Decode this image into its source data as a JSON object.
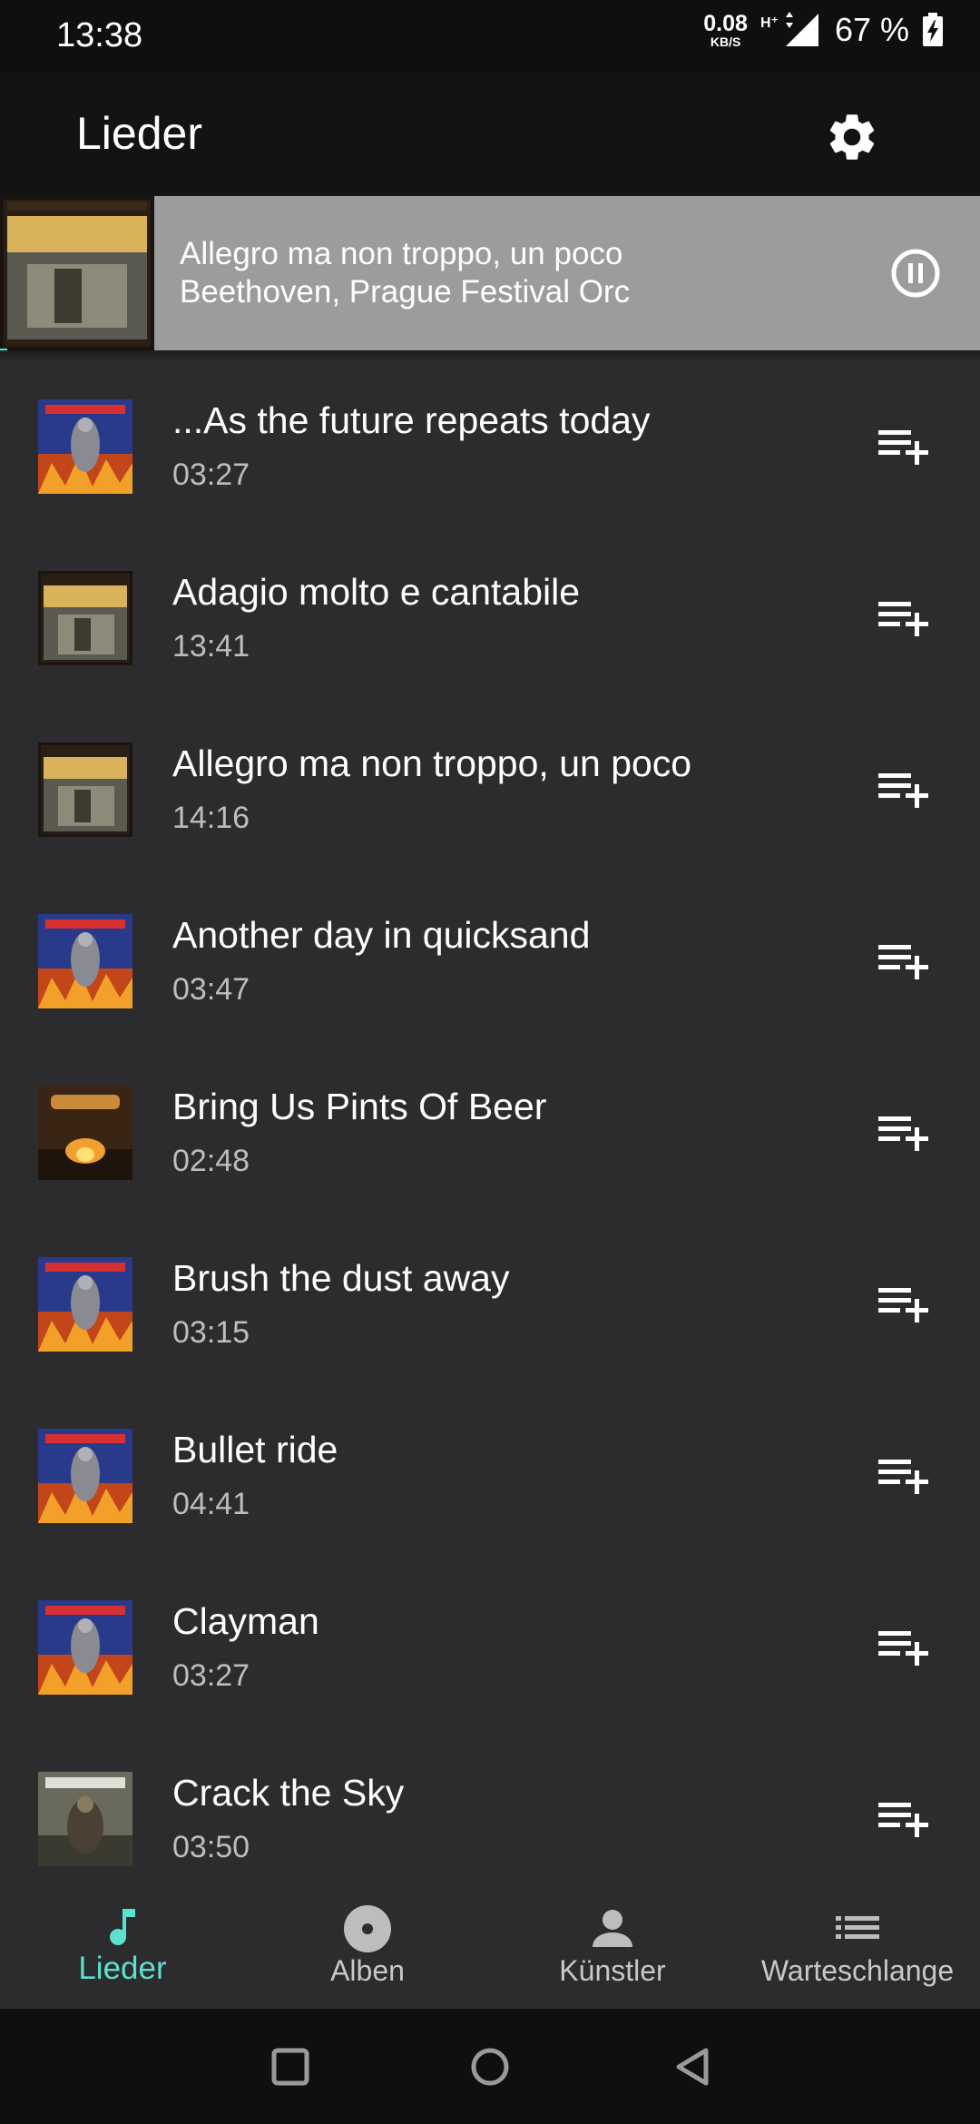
{
  "status": {
    "time": "13:38",
    "net_speed": "0.08",
    "net_unit": "KB/S",
    "network_type": "H⁺",
    "battery": "67 %"
  },
  "appbar": {
    "title": "Lieder",
    "settings_icon": "gear-icon"
  },
  "now_playing": {
    "title": "Allegro ma non troppo, un poco",
    "artist": "Beethoven, Prague Festival Orc",
    "control_icon": "pause-circle-icon"
  },
  "songs": [
    {
      "title": "...As the future repeats today",
      "duration": "03:27",
      "cover": "inflames"
    },
    {
      "title": "Adagio molto e cantabile",
      "duration": "13:41",
      "cover": "beethoven"
    },
    {
      "title": "Allegro ma non troppo, un poco",
      "duration": "14:16",
      "cover": "beethoven"
    },
    {
      "title": "Another day in quicksand",
      "duration": "03:47",
      "cover": "inflames"
    },
    {
      "title": "Bring Us Pints Of Beer",
      "duration": "02:48",
      "cover": "korpiklaani"
    },
    {
      "title": "Brush the dust away",
      "duration": "03:15",
      "cover": "inflames"
    },
    {
      "title": "Bullet ride",
      "duration": "04:41",
      "cover": "inflames"
    },
    {
      "title": "Clayman",
      "duration": "03:27",
      "cover": "inflames"
    },
    {
      "title": "Crack the Sky",
      "duration": "03:50",
      "cover": "amonamarth"
    }
  ],
  "nav": {
    "items": [
      {
        "label": "Lieder",
        "icon": "music-note-icon",
        "active": true
      },
      {
        "label": "Alben",
        "icon": "disc-icon",
        "active": false
      },
      {
        "label": "Künstler",
        "icon": "person-icon",
        "active": false
      },
      {
        "label": "Warteschlange",
        "icon": "queue-list-icon",
        "active": false
      }
    ]
  },
  "colors": {
    "accent": "#5ce0d0",
    "background": "#2c2c2e",
    "now_playing_bg": "#9c9c9e"
  }
}
